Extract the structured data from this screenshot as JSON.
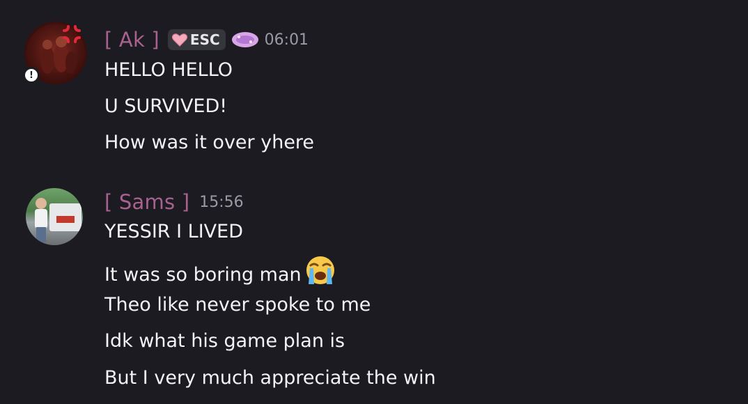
{
  "messages": [
    {
      "username": "[ Ak ]",
      "tag_label": "ESC",
      "timestamp": "06:01",
      "lines": [
        "HELLO HELLO",
        "U SURVIVED!",
        "How was it over yhere"
      ]
    },
    {
      "username": "[ Sams ]",
      "timestamp": "15:56",
      "lines": [
        "YESSIR I LIVED",
        "It was so boring man",
        "Theo like never spoke to me",
        "Idk what his game plan is",
        "But I very much appreciate the win"
      ],
      "emoji": "loudly-crying-face"
    }
  ],
  "colors": {
    "background": "#1c1b21",
    "username": "#a8628f",
    "timestamp": "#9a9ba2",
    "text": "#f2f3f5"
  }
}
